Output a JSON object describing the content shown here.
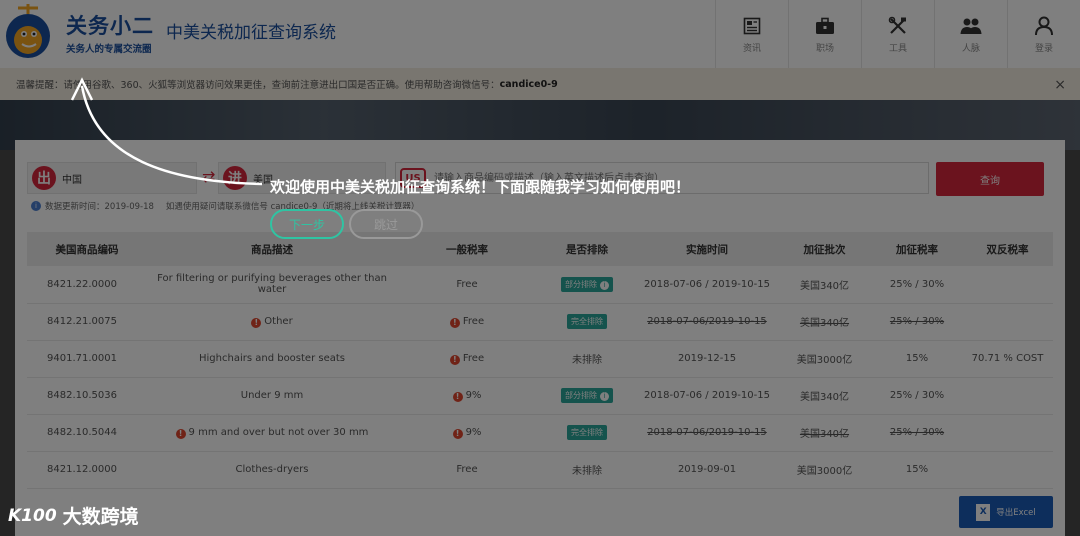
{
  "header": {
    "brand_name": "关务小二",
    "brand_slogan": "关务人的专属交流圈",
    "system_title": "中美关税加征查询系统",
    "nav": [
      {
        "label": "资讯",
        "icon": "news-icon"
      },
      {
        "label": "职场",
        "icon": "briefcase-icon"
      },
      {
        "label": "工具",
        "icon": "tools-icon"
      },
      {
        "label": "人脉",
        "icon": "people-icon"
      },
      {
        "label": "登录",
        "icon": "user-icon"
      }
    ]
  },
  "tip": {
    "text": "温馨提醒：请使用谷歌、360、火狐等浏览器访问效果更佳，查询前注意进出口国是否正确。使用帮助咨询微信号：",
    "wechat": "candice0-9",
    "close": "×"
  },
  "search": {
    "from_flag": "出",
    "from_country": "中国",
    "swap": "⇄",
    "to_flag": "进",
    "to_country": "美国",
    "us_badge": "US",
    "placeholder": "请输入商品编码或描述（输入英文描述后点击查询）",
    "query_button": "查询",
    "update_info": "数据更新时间：2019-09-18",
    "help_info": "如遇使用疑问请联系微信号 candice0-9（近期将上线关税计算器）"
  },
  "table": {
    "headers": [
      "美国商品编码",
      "商品描述",
      "一般税率",
      "是否排除",
      "实施时间",
      "加征批次",
      "加征税率",
      "双反税率"
    ],
    "rows": [
      {
        "code": "8421.22.0000",
        "desc": "For filtering or purifying beverages other than water",
        "desc_warn": false,
        "rate": "Free",
        "rate_warn": false,
        "excluded": "部分排除",
        "excl_type": "partial",
        "date": "2018-07-06 / 2019-10-15",
        "batch": "美国340亿",
        "add_rate": "25% / 30%",
        "ad_rate": "",
        "strike": false
      },
      {
        "code": "8412.21.0075",
        "desc": "Other",
        "desc_warn": true,
        "rate": "Free",
        "rate_warn": true,
        "excluded": "完全排除",
        "excl_type": "full",
        "date": "2018-07-06/2019-10-15",
        "batch": "美国340亿",
        "add_rate": "25% / 30%",
        "ad_rate": "",
        "strike": true
      },
      {
        "code": "9401.71.0001",
        "desc": "Highchairs and booster seats",
        "desc_warn": false,
        "rate": "Free",
        "rate_warn": true,
        "excluded": "未排除",
        "excl_type": "none",
        "date": "2019-12-15",
        "batch": "美国3000亿",
        "add_rate": "15%",
        "ad_rate": "70.71 % COST",
        "strike": false
      },
      {
        "code": "8482.10.5036",
        "desc": "Under 9 mm",
        "desc_warn": false,
        "rate": "9%",
        "rate_warn": true,
        "excluded": "部分排除",
        "excl_type": "partial",
        "date": "2018-07-06 / 2019-10-15",
        "batch": "美国340亿",
        "add_rate": "25% / 30%",
        "ad_rate": "",
        "strike": false
      },
      {
        "code": "8482.10.5044",
        "desc": "9 mm and over but not over 30 mm",
        "desc_warn": true,
        "rate": "9%",
        "rate_warn": true,
        "excluded": "完全排除",
        "excl_type": "full",
        "date": "2018-07-06/2019-10-15",
        "batch": "美国340亿",
        "add_rate": "25% / 30%",
        "ad_rate": "",
        "strike": true
      },
      {
        "code": "8421.12.0000",
        "desc": "Clothes-dryers",
        "desc_warn": false,
        "rate": "Free",
        "rate_warn": false,
        "excluded": "未排除",
        "excl_type": "none",
        "date": "2019-09-01",
        "batch": "美国3000亿",
        "add_rate": "15%",
        "ad_rate": "",
        "strike": false
      }
    ]
  },
  "export_button": "导出Excel",
  "export_icon_text": "X",
  "tour": {
    "message": "欢迎使用中美关税加征查询系统！下面跟随我学习如何使用吧！",
    "next": "下一步",
    "skip": "跳过"
  },
  "watermark": {
    "logo": "K100",
    "text": "大数跨境"
  },
  "colors": {
    "brand_blue": "#1a4f9e",
    "accent_red": "#d7263d",
    "badge_teal": "#2aa69a",
    "export_blue": "#1a5db8",
    "tour_green": "#2fc4a3"
  }
}
